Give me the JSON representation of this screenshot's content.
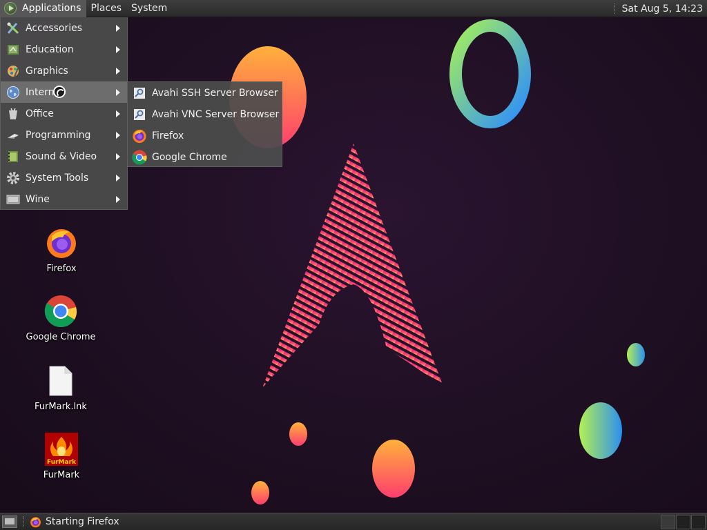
{
  "top_panel": {
    "menus": [
      {
        "label": "Applications",
        "active": true
      },
      {
        "label": "Places",
        "active": false
      },
      {
        "label": "System",
        "active": false
      }
    ],
    "clock": "Sat Aug  5, 14:23"
  },
  "app_menu": {
    "items": [
      {
        "label": "Accessories",
        "icon": "accessories-icon",
        "has_submenu": true
      },
      {
        "label": "Education",
        "icon": "education-icon",
        "has_submenu": true
      },
      {
        "label": "Graphics",
        "icon": "graphics-icon",
        "has_submenu": true
      },
      {
        "label": "Internet",
        "icon": "globe-icon",
        "has_submenu": true,
        "highlighted": true
      },
      {
        "label": "Office",
        "icon": "office-icon",
        "has_submenu": true
      },
      {
        "label": "Programming",
        "icon": "programming-icon",
        "has_submenu": true
      },
      {
        "label": "Sound & Video",
        "icon": "sound-video-icon",
        "has_submenu": true
      },
      {
        "label": "System Tools",
        "icon": "gear-icon",
        "has_submenu": true
      },
      {
        "label": "Wine",
        "icon": "wine-icon",
        "has_submenu": true
      }
    ]
  },
  "internet_submenu": {
    "items": [
      {
        "label": "Avahi SSH Server Browser",
        "icon": "avahi-icon"
      },
      {
        "label": "Avahi VNC Server Browser",
        "icon": "avahi-icon"
      },
      {
        "label": "Firefox",
        "icon": "firefox-icon"
      },
      {
        "label": "Google Chrome",
        "icon": "chrome-icon"
      }
    ]
  },
  "desktop_icons": [
    {
      "label": "Firefox",
      "icon": "firefox-icon"
    },
    {
      "label": "Google Chrome",
      "icon": "chrome-icon"
    },
    {
      "label": "FurMark.lnk",
      "icon": "file-icon"
    },
    {
      "label": "FurMark",
      "icon": "furmark-icon"
    }
  ],
  "furmark_icon_text": "FurMark",
  "bottom_panel": {
    "task_label": "Starting Firefox",
    "workspaces": 3
  },
  "colors": {
    "panel": "#2b2b2b",
    "menu": "#4c4c4c",
    "highlight": "#7d7d7d",
    "wallpaper": "#1e0f22"
  }
}
